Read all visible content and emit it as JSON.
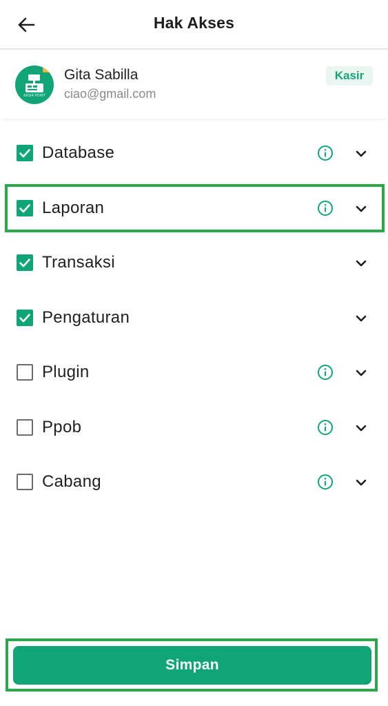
{
  "app_bar": {
    "title": "Hak Akses",
    "back_icon": "arrow-left-icon"
  },
  "user": {
    "name": "Gita Sabilla",
    "email": "ciao@gmail.com",
    "role": "Kasir",
    "avatar_caption": "KASIR POINT"
  },
  "permissions": [
    {
      "label": "Database",
      "checked": true,
      "has_info": true,
      "highlighted": false
    },
    {
      "label": "Laporan",
      "checked": true,
      "has_info": true,
      "highlighted": true
    },
    {
      "label": "Transaksi",
      "checked": true,
      "has_info": false,
      "highlighted": false
    },
    {
      "label": "Pengaturan",
      "checked": true,
      "has_info": false,
      "highlighted": false
    },
    {
      "label": "Plugin",
      "checked": false,
      "has_info": true,
      "highlighted": false
    },
    {
      "label": "Ppob",
      "checked": false,
      "has_info": true,
      "highlighted": false
    },
    {
      "label": "Cabang",
      "checked": false,
      "has_info": true,
      "highlighted": false
    }
  ],
  "footer": {
    "save_label": "Simpan"
  },
  "colors": {
    "primary": "#10a575",
    "highlight": "#2aa84a",
    "badge_bg": "#eaf7f1"
  }
}
